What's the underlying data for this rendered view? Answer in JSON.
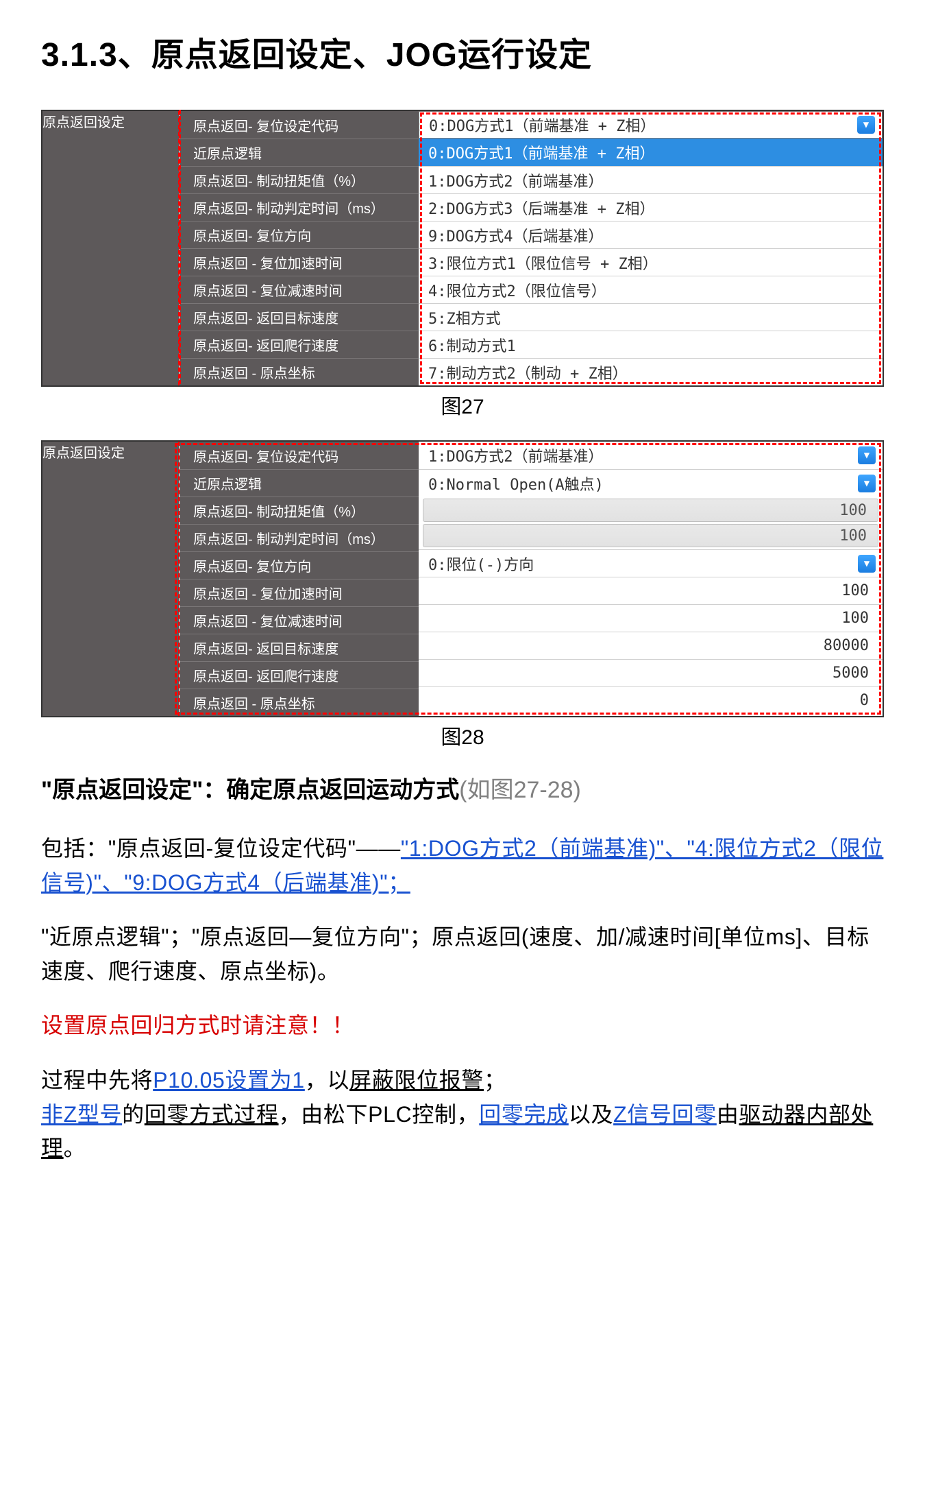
{
  "title": "3.1.3、原点返回设定、JOG运行设定",
  "figure27": {
    "caption": "图27",
    "leftLabel": "原点返回设定",
    "paramLabels": [
      "原点返回- 复位设定代码",
      "近原点逻辑",
      "原点返回- 制动扭矩值（%）",
      "原点返回- 制动判定时间（ms）",
      "原点返回- 复位方向",
      "原点返回 - 复位加速时间",
      "原点返回 - 复位减速时间",
      "原点返回- 返回目标速度",
      "原点返回- 返回爬行速度",
      "原点返回 - 原点坐标"
    ],
    "headerValue": "0:DOG方式1（前端基准 + Z相）",
    "dropdownOptions": [
      "0:DOG方式1（前端基准 + Z相）",
      "1:DOG方式2（前端基准）",
      "2:DOG方式3（后端基准 + Z相）",
      "9:DOG方式4（后端基准）",
      "3:限位方式1（限位信号 + Z相）",
      "4:限位方式2（限位信号）",
      "5:Z相方式",
      "6:制动方式1",
      "7:制动方式2（制动 + Z相）"
    ]
  },
  "figure28": {
    "caption": "图28",
    "leftLabel": "原点返回设定",
    "paramLabels": [
      "原点返回- 复位设定代码",
      "近原点逻辑",
      "原点返回- 制动扭矩值（%）",
      "原点返回- 制动判定时间（ms）",
      "原点返回- 复位方向",
      "原点返回 - 复位加速时间",
      "原点返回 - 复位减速时间",
      "原点返回- 返回目标速度",
      "原点返回- 返回爬行速度",
      "原点返回 - 原点坐标"
    ],
    "values": [
      {
        "text": "1:DOG方式2（前端基准）",
        "type": "dropdown"
      },
      {
        "text": "0:Normal Open(A触点)",
        "type": "dropdown"
      },
      {
        "text": "100",
        "type": "disabled"
      },
      {
        "text": "100",
        "type": "disabled"
      },
      {
        "text": "0:限位(-)方向",
        "type": "dropdown"
      },
      {
        "text": "100",
        "type": "input"
      },
      {
        "text": "100",
        "type": "input"
      },
      {
        "text": "80000",
        "type": "input"
      },
      {
        "text": "5000",
        "type": "input"
      },
      {
        "text": "0",
        "type": "input"
      }
    ]
  },
  "subhead": {
    "bold": "\"原点返回设定\"：确定原点返回运动方式",
    "gray": "(如图27-28)"
  },
  "para1": {
    "pre": "包括：\"原点返回-复位设定代码\"——",
    "link1": "\"1:DOG方式2（前端基准)\"、\"4:限位方式2（限位信号)\"、\"9:DOG方式4（后端基准)\"；"
  },
  "para2": "\"近原点逻辑\"；\"原点返回—复位方向\"；原点返回(速度、加/减速时间[单位ms]、目标速度、爬行速度、原点坐标)。",
  "warn": "设置原点回归方式时请注意！！",
  "para3": {
    "t1": "过程中先将",
    "l1": "P10.05设置为1",
    "t2": "，以",
    "u1": "屏蔽限位报警",
    "t3": "；"
  },
  "para4": {
    "l1": "非Z型号",
    "t1": "的",
    "u1": "回零方式过程",
    "t2": "，由松下PLC控制，",
    "l2": "回零完成",
    "t3": "以及",
    "l3": "Z信号回零",
    "t4": "由",
    "u2": "驱动器内部处理",
    "t5": "。"
  }
}
